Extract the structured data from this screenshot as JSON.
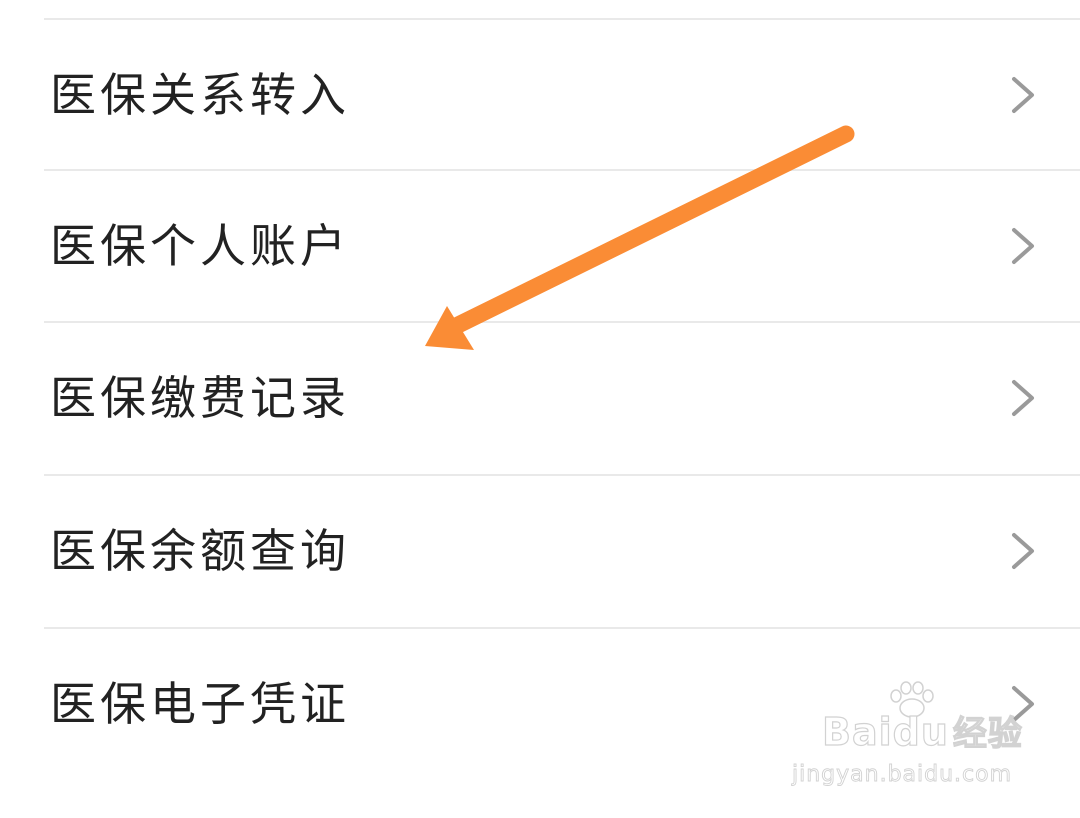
{
  "menu": {
    "items": [
      {
        "label": "医保关系转入"
      },
      {
        "label": "医保个人账户"
      },
      {
        "label": "医保缴费记录"
      },
      {
        "label": "医保余额查询"
      },
      {
        "label": "医保电子凭证"
      }
    ]
  },
  "annotation": {
    "arrow_color": "#fa8c35",
    "points_to": "医保缴费记录"
  },
  "watermark": {
    "logo_text_brand": "Baidu",
    "logo_text_product": "经验",
    "url": "jingyan.baidu.com"
  },
  "colors": {
    "background": "#ffffff",
    "divider": "#e9e9e9",
    "label": "#222222",
    "chevron": "#9a9a9a"
  },
  "icons": {
    "row_chevron": "chevron-right-icon",
    "watermark_paw": "paw-icon"
  }
}
